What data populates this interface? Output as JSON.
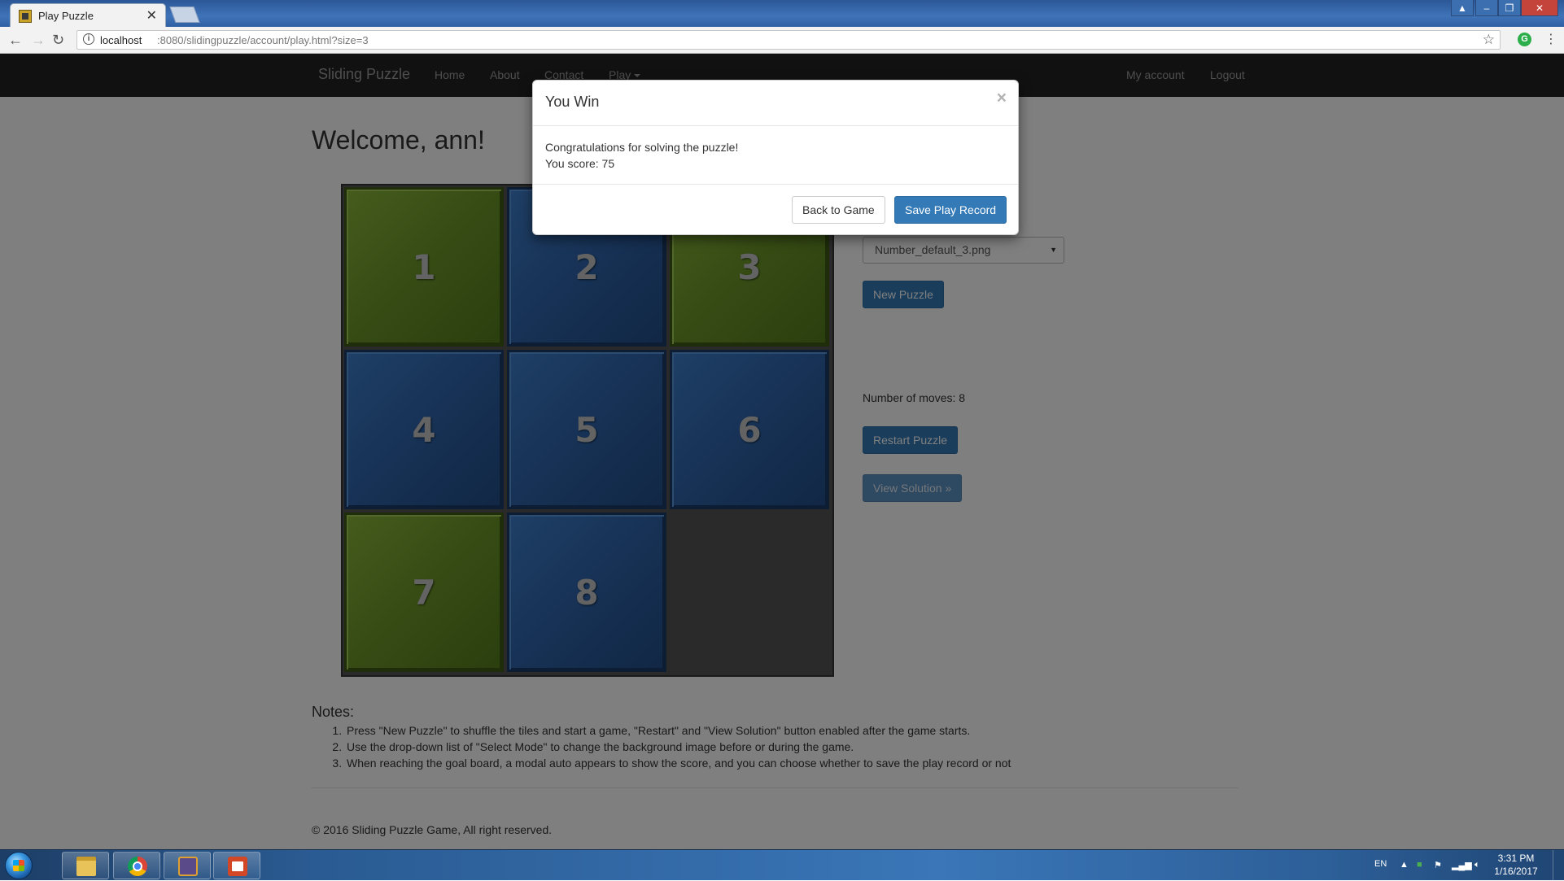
{
  "browser": {
    "tab_title": "Play Puzzle",
    "url_host": "localhost",
    "url_rest": ":8080/slidingpuzzle/account/play.html?size=3"
  },
  "nav": {
    "brand": "Sliding Puzzle",
    "links": [
      "Home",
      "About",
      "Contact",
      "Play"
    ],
    "right_links": [
      "My account",
      "Logout"
    ]
  },
  "welcome": "Welcome, ann!",
  "board": {
    "size": 3,
    "tiles": [
      {
        "label": "1",
        "color": "green"
      },
      {
        "label": "2",
        "color": "blue"
      },
      {
        "label": "3",
        "color": "green"
      },
      {
        "label": "4",
        "color": "blue"
      },
      {
        "label": "5",
        "color": "blue"
      },
      {
        "label": "6",
        "color": "blue"
      },
      {
        "label": "7",
        "color": "green"
      },
      {
        "label": "8",
        "color": "blue"
      },
      null
    ],
    "colors": {
      "green": "#6f9a2a",
      "blue": "#2f66ae",
      "empty": "#555555"
    }
  },
  "controls": {
    "select_mode_value": "Number_default_3.png",
    "new_puzzle": "New Puzzle",
    "moves_label": "Number of moves: 8",
    "restart": "Restart Puzzle",
    "view_solution": "View Solution »"
  },
  "notes": {
    "title": "Notes:",
    "items": [
      "Press \"New Puzzle\" to shuffle the tiles and start a game, \"Restart\" and \"View Solution\" button enabled after the game starts.",
      "Use the drop-down list of \"Select Mode\" to change the background image before or during the game.",
      "When reaching the goal board, a modal auto appears to show the score, and you can choose whether to save the play record or not"
    ]
  },
  "footer": "© 2016 Sliding Puzzle Game, All right reserved.",
  "modal": {
    "title": "You Win",
    "close": "×",
    "message": "Congratulations for solving the puzzle!",
    "score_line": "You score: 75",
    "back_button": "Back to Game",
    "save_button": "Save Play Record"
  },
  "taskbar": {
    "language": "EN",
    "time": "3:31 PM",
    "date": "1/16/2017"
  },
  "accent_color": "#337ab7"
}
